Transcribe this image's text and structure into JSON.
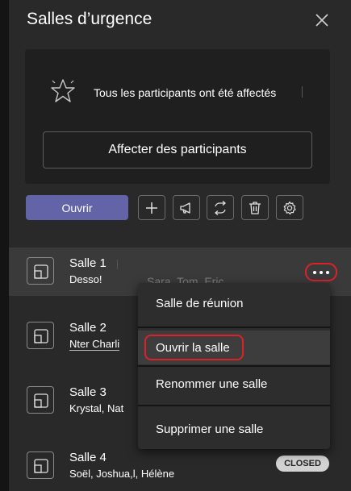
{
  "header": {
    "title": "Salles d’urgence"
  },
  "status_card": {
    "message": "Tous les participants ont été affectés",
    "assign_label": "Affecter des participants"
  },
  "toolbar": {
    "open_label": "Ouvrir"
  },
  "rooms": [
    {
      "name": "Salle 1",
      "people": "Desso!",
      "assigned": "Sara, Tom, Eric"
    },
    {
      "name": "Salle 2",
      "people": "Nter Charli"
    },
    {
      "name": "Salle 3",
      "people": "Krystal, Nat"
    },
    {
      "name": "Salle 4",
      "people": "Soël, Joshua,l, Hélène",
      "status": "CLOSED"
    }
  ],
  "context_menu": {
    "items": [
      "Salle de réunion",
      "Ouvrir la salle",
      "Renommer une salle",
      "Supprimer une salle"
    ]
  },
  "colors": {
    "accent": "#6264a7",
    "highlight_ring": "#d9222a",
    "panel": "#292929"
  }
}
